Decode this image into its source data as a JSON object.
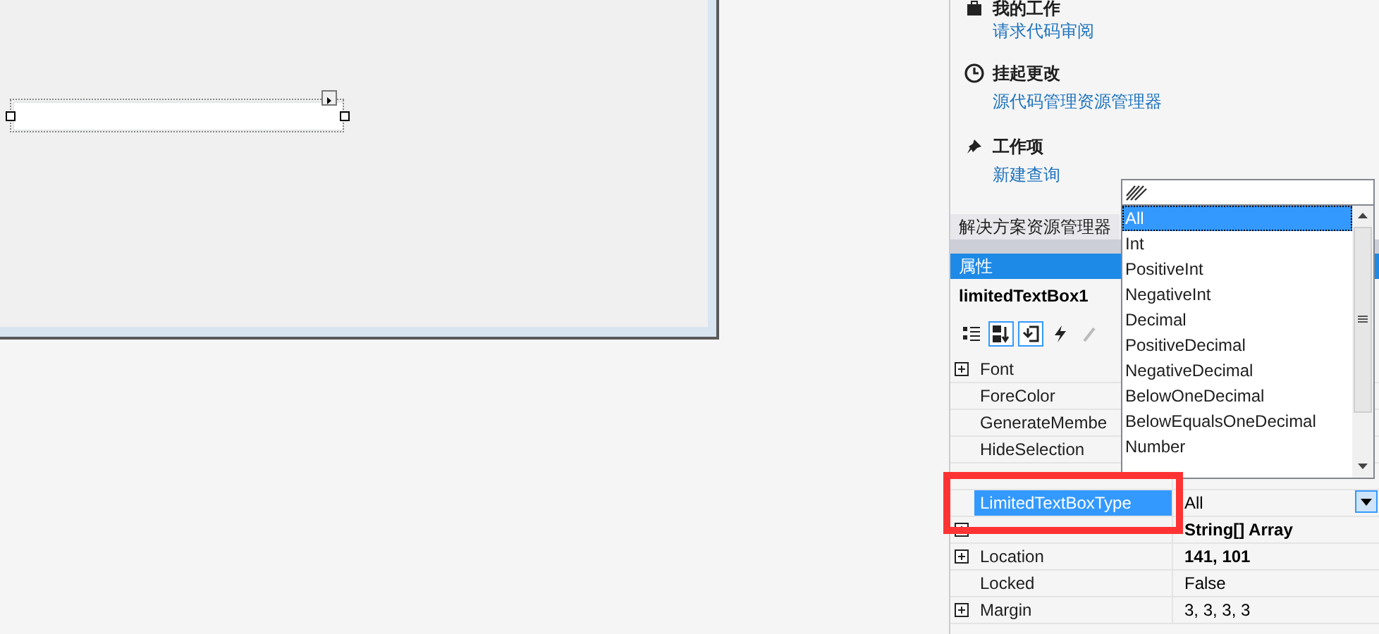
{
  "designer": {
    "textbox": {
      "selected": true
    }
  },
  "team_explorer": {
    "sections": [
      {
        "kind": "work",
        "title": "我的工作",
        "link": "请求代码审阅"
      },
      {
        "kind": "pending",
        "title": "挂起更改",
        "link": "源代码管理资源管理器"
      },
      {
        "kind": "workitems",
        "title": "工作项",
        "link": "新建查询"
      }
    ]
  },
  "solution_tab": {
    "label": "解决方案资源管理器"
  },
  "properties": {
    "title": "属性",
    "object_name": "limitedTextBox1",
    "toolbar": [
      {
        "kind": "categorized",
        "selected": false
      },
      {
        "kind": "alphabetical",
        "selected": true
      },
      {
        "kind": "properties",
        "selected": true
      },
      {
        "kind": "events",
        "selected": false
      },
      {
        "kind": "pages",
        "selected": false
      }
    ],
    "rows": [
      {
        "name": "Font",
        "expandable": true,
        "selected": false
      },
      {
        "name": "ForeColor",
        "expandable": false,
        "selected": false
      },
      {
        "name": "GenerateMembe",
        "expandable": false,
        "selected": false
      },
      {
        "name": "HideSelection",
        "expandable": false,
        "selected": false
      },
      {
        "expandable": false,
        "selected": false
      },
      {
        "name": "LimitedTextBoxType",
        "value": "All",
        "expandable": false,
        "selected": true,
        "modified": false
      },
      {
        "value": "String[] Array",
        "expandable": true,
        "selected": false,
        "modified": true
      },
      {
        "name": "Location",
        "value": "141, 101",
        "expandable": true,
        "selected": false,
        "modified": true
      },
      {
        "name": "Locked",
        "value": "False",
        "expandable": false,
        "selected": false,
        "modified": false
      },
      {
        "name": "Margin",
        "value": "3, 3, 3, 3",
        "expandable": true,
        "selected": false,
        "modified": false
      }
    ]
  },
  "dropdown": {
    "items": [
      {
        "label": "All",
        "selected": true
      },
      {
        "label": "Int",
        "selected": false
      },
      {
        "label": "PositiveInt",
        "selected": false
      },
      {
        "label": "NegativeInt",
        "selected": false
      },
      {
        "label": "Decimal",
        "selected": false
      },
      {
        "label": "PositiveDecimal",
        "selected": false
      },
      {
        "label": "NegativeDecimal",
        "selected": false
      },
      {
        "label": "BelowOneDecimal",
        "selected": false
      },
      {
        "label": "BelowEqualsOneDecimal",
        "selected": false
      },
      {
        "label": "Number",
        "selected": false
      }
    ]
  },
  "highlight": {
    "on": true
  }
}
